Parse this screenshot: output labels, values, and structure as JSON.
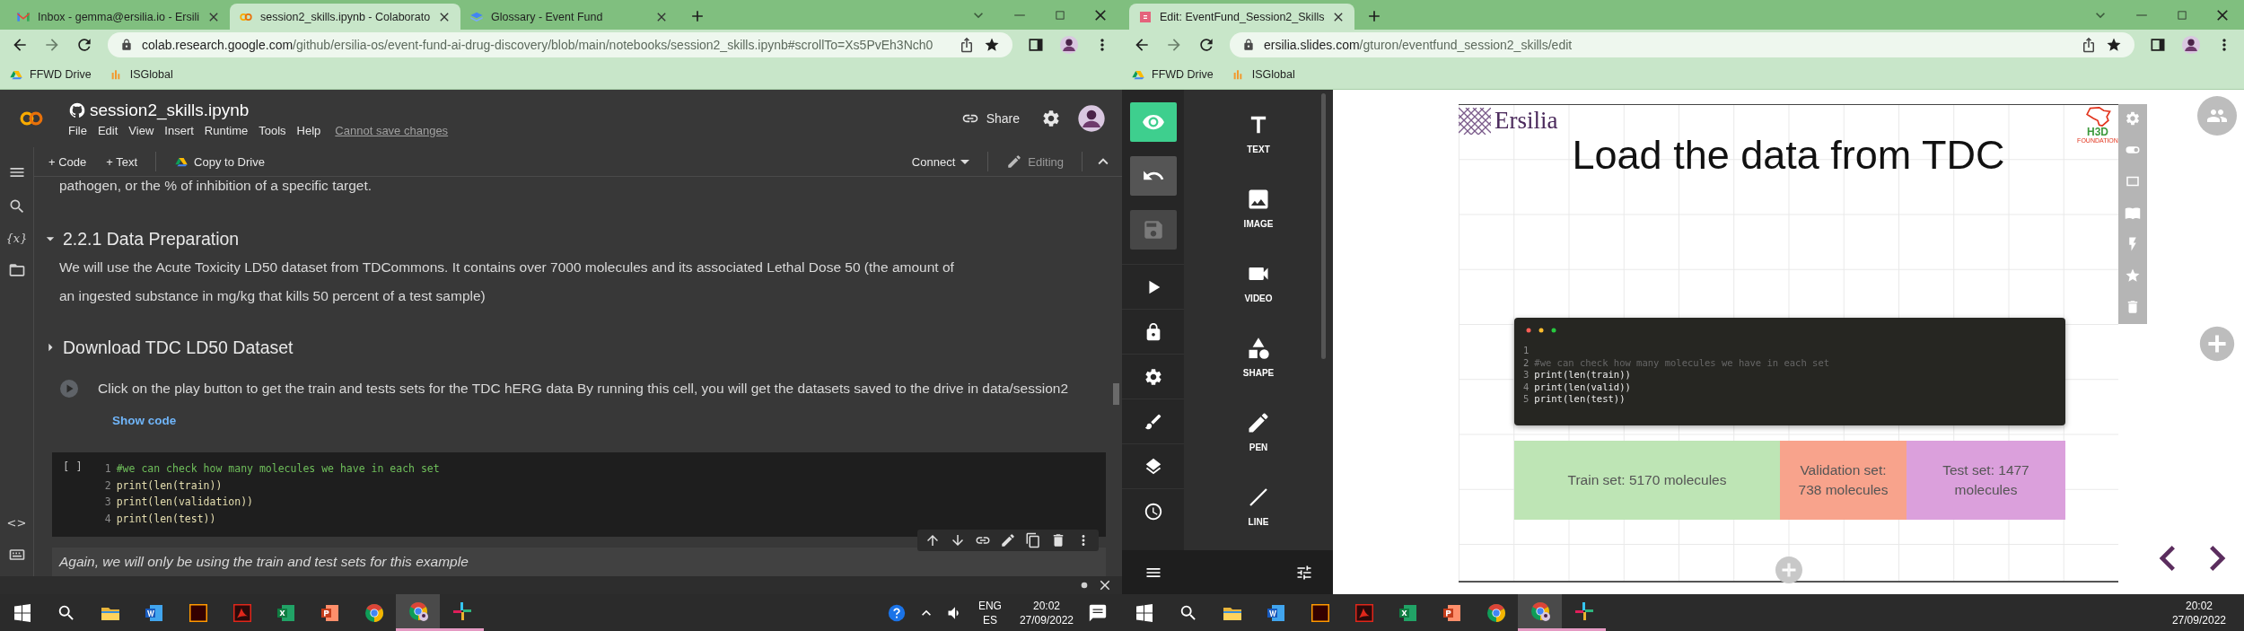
{
  "windows": [
    {
      "tabs": [
        {
          "title": "Inbox - gemma@ersilia.io - Ersili",
          "kind": "gmail",
          "selected": false
        },
        {
          "title": "session2_skills.ipynb - Colaborato",
          "kind": "colab",
          "selected": true
        },
        {
          "title": "Glossary - Event Fund",
          "kind": "glossary",
          "selected": false
        }
      ],
      "url": {
        "host": "colab.research.google.com",
        "path": "/github/ersilia-os/event-fund-ai-drug-discovery/blob/main/notebooks/session2_skills.ipynb#scrollTo=Xs5PvEh3Nch0"
      },
      "bookmarks": [
        {
          "label": "FFWD Drive",
          "kind": "drive"
        },
        {
          "label": "ISGlobal",
          "kind": "isglobal"
        }
      ],
      "colab": {
        "title": "session2_skills.ipynb",
        "menu": [
          "File",
          "Edit",
          "View",
          "Insert",
          "Runtime",
          "Tools",
          "Help"
        ],
        "notice": "Cannot save changes",
        "share": "Share",
        "toolbar": {
          "add_code": "+ Code",
          "add_text": "+ Text",
          "copy": "Copy to Drive",
          "connect": "Connect",
          "mode": "Editing"
        },
        "sidebar_top": [
          {
            "kind": "toc"
          },
          {
            "kind": "search"
          },
          {
            "kind": "variables",
            "label": "{x}"
          },
          {
            "kind": "files"
          }
        ],
        "sidebar_bottom": [
          {
            "kind": "snippets",
            "label": "<>"
          },
          {
            "kind": "terminal"
          }
        ],
        "cells": [
          {
            "kind": "text",
            "text": "pathogen, or the % of inhibition of a specific target.",
            "italic": false,
            "focused": false
          },
          {
            "kind": "heading",
            "text": "2.2.1 Data Preparation",
            "expanded": true
          },
          {
            "kind": "text",
            "text": "We will use the Acute Toxicity LD50 dataset from TDCommons. It contains over 7000 molecules and its associated Lethal Dose 50 (the amount of an ingested substance in mg/kg that kills 50 percent of a test sample)",
            "italic": false,
            "focused": false
          },
          {
            "kind": "heading",
            "text": "Download TDC LD50 Dataset",
            "expanded": false
          },
          {
            "kind": "form",
            "text": "Click on the play button to get the train and tests sets for the TDC hERG data By running this cell, you will get the datasets saved to the drive in data/session2",
            "link": "Show code"
          },
          {
            "kind": "code",
            "gutter": "[ ]",
            "lines": [
              {
                "num": "1",
                "kind": "comment",
                "text": "#we can check how many molecules we have in each set"
              },
              {
                "num": "2",
                "kind": "code",
                "text": "print(len(train))"
              },
              {
                "num": "3",
                "kind": "code",
                "text": "print(len(validation))"
              },
              {
                "num": "4",
                "kind": "code",
                "text": "print(len(test))"
              }
            ]
          },
          {
            "kind": "text",
            "text": "Again, we will only be using the train and test sets for this example",
            "italic": true,
            "focused": true
          }
        ]
      },
      "taskbar": {
        "apps": [
          {
            "kind": "start",
            "running": false,
            "active": false
          },
          {
            "kind": "search",
            "running": false,
            "active": false
          },
          {
            "kind": "explorer",
            "running": false,
            "active": false
          },
          {
            "kind": "word",
            "running": false,
            "active": false
          },
          {
            "kind": "illustrator",
            "running": false,
            "active": false
          },
          {
            "kind": "acrobat",
            "running": false,
            "active": false
          },
          {
            "kind": "excel",
            "running": false,
            "active": false
          },
          {
            "kind": "powerpoint",
            "running": false,
            "active": false
          },
          {
            "kind": "chrome",
            "running": false,
            "active": false
          },
          {
            "kind": "chrome_profile",
            "running": true,
            "active": true
          },
          {
            "kind": "slack",
            "running": true,
            "active": false
          }
        ],
        "tray": {
          "icons": [
            {
              "kind": "help"
            },
            {
              "kind": "overflow"
            },
            {
              "kind": "volume"
            }
          ],
          "lang": "ENG",
          "region": "ES",
          "time": "20:02",
          "date": "27/09/2022",
          "notifications": true
        }
      }
    },
    {
      "tabs": [
        {
          "title": "Edit: EventFund_Session2_Skills",
          "kind": "slides",
          "selected": true
        }
      ],
      "url": {
        "host": "ersilia.slides.com",
        "path": "/gturon/eventfund_session2_skills/edit"
      },
      "bookmarks": [
        {
          "label": "FFWD Drive",
          "kind": "drive"
        },
        {
          "label": "ISGlobal",
          "kind": "isglobal"
        }
      ],
      "slides": {
        "actions": [
          {
            "kind": "preview",
            "selected": true,
            "disabled": false
          },
          {
            "kind": "undo",
            "selected": false,
            "disabled": false
          },
          {
            "kind": "save",
            "selected": false,
            "disabled": true
          }
        ],
        "nav": [
          {
            "kind": "present"
          },
          {
            "kind": "lock"
          },
          {
            "kind": "settings"
          },
          {
            "kind": "style"
          },
          {
            "kind": "arrange"
          },
          {
            "kind": "history"
          }
        ],
        "tools": [
          {
            "label": "TEXT",
            "kind": "text"
          },
          {
            "label": "IMAGE",
            "kind": "image"
          },
          {
            "label": "VIDEO",
            "kind": "video"
          },
          {
            "label": "SHAPE",
            "kind": "shape"
          },
          {
            "label": "PEN",
            "kind": "pen"
          },
          {
            "label": "LINE",
            "kind": "line"
          }
        ],
        "slide": {
          "brand": "Ersilia",
          "partner": "H3D",
          "partner_sub": "FOUNDATION",
          "title": "Load the data from TDC",
          "code": [
            {
              "num": "1",
              "kind": "blank"
            },
            {
              "num": "2",
              "kind": "comment",
              "text": "#we can check how many molecules we have in each set"
            },
            {
              "num": "3",
              "kind": "code",
              "text": "print(len(train))"
            },
            {
              "num": "4",
              "kind": "code",
              "text": "print(len(valid))"
            },
            {
              "num": "5",
              "kind": "code",
              "text": "print(len(test))"
            }
          ],
          "blocks": [
            {
              "text": "Train set: 5170 molecules",
              "color": "#bee5b5"
            },
            {
              "text": "Validation set: 738 molecules",
              "color": "#f8a38c"
            },
            {
              "text": "Test set: 1477 molecules",
              "color": "#dba0dc"
            }
          ]
        },
        "slide_tools": [
          {
            "kind": "settings"
          },
          {
            "kind": "toggle"
          },
          {
            "kind": "frame"
          },
          {
            "kind": "notes"
          },
          {
            "kind": "animate"
          },
          {
            "kind": "favorite"
          },
          {
            "kind": "delete"
          }
        ]
      },
      "taskbar": {
        "apps": [
          {
            "kind": "start",
            "running": false,
            "active": false
          },
          {
            "kind": "search",
            "running": false,
            "active": false
          },
          {
            "kind": "explorer",
            "running": false,
            "active": false
          },
          {
            "kind": "word",
            "running": false,
            "active": false
          },
          {
            "kind": "illustrator",
            "running": false,
            "active": false
          },
          {
            "kind": "acrobat",
            "running": false,
            "active": false
          },
          {
            "kind": "excel",
            "running": false,
            "active": false
          },
          {
            "kind": "powerpoint",
            "running": false,
            "active": false
          },
          {
            "kind": "chrome",
            "running": false,
            "active": false
          },
          {
            "kind": "chrome_profile",
            "running": true,
            "active": true
          },
          {
            "kind": "slack",
            "running": true,
            "active": false
          }
        ],
        "tray": {
          "time": "20:02",
          "date": "27/09/2022"
        }
      }
    }
  ]
}
